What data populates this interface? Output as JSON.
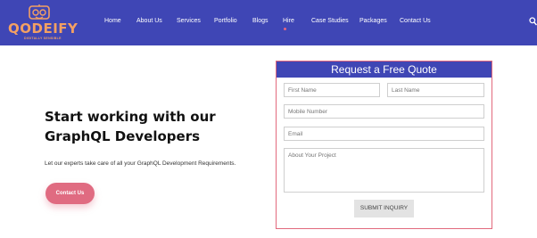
{
  "brand": {
    "name": "QODEIFY",
    "tagline": "DIGITALLY SENSIBLE"
  },
  "nav": {
    "items": [
      "Home",
      "About Us",
      "Services",
      "Portfolio",
      "Blogs",
      "Hire",
      "Case Studies",
      "Packages",
      "Contact Us"
    ],
    "active": "Hire",
    "search_icon": "search-icon"
  },
  "hero": {
    "title": "Start working with our GraphQL Developers",
    "text": "Let our experts take care of all your GraphQL Development Requirements.",
    "cta_label": "Contact Us"
  },
  "quote_form": {
    "heading": "Request a Free Quote",
    "first_name_placeholder": "First Name",
    "last_name_placeholder": "Last Name",
    "mobile_placeholder": "Mobile Number",
    "email_placeholder": "Email",
    "project_placeholder": "About Your Project",
    "submit_label": "SUBMIT INQUIRY"
  },
  "colors": {
    "nav_bg": "#3f46b5",
    "accent_pink": "#e06b81",
    "logo_orange": "#f3a063"
  }
}
